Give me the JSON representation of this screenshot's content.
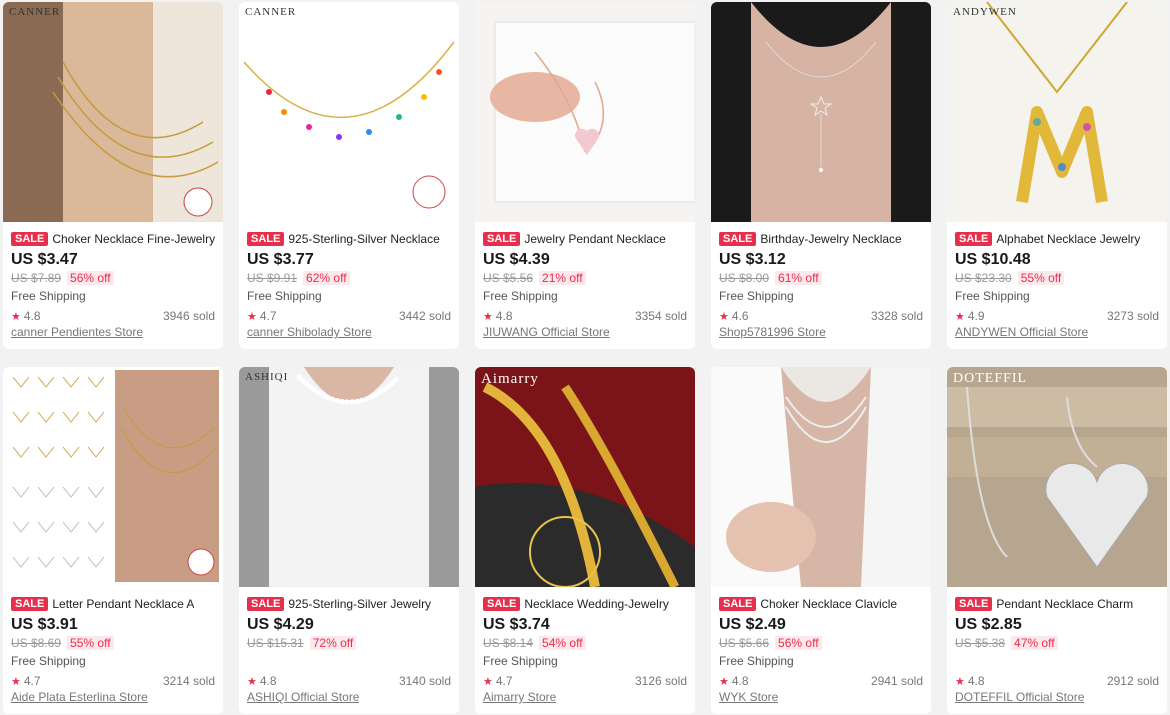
{
  "theme": {
    "sale_color": "#e62e4d",
    "background": "#f2f2f2"
  },
  "products": [
    {
      "brand": "CANNER",
      "sale": "SALE",
      "title": "Choker Necklace Fine-Jewelry",
      "price": "US $3.47",
      "old_price": "US $7.89",
      "discount": "56% off",
      "shipping": "Free Shipping",
      "rating": "4.8",
      "sold": "3946 sold",
      "store": "canner Pendientes Store"
    },
    {
      "brand": "CANNER",
      "sale": "SALE",
      "title": "925-Sterling-Silver Necklace",
      "price": "US $3.77",
      "old_price": "US $9.91",
      "discount": "62% off",
      "shipping": "Free Shipping",
      "rating": "4.7",
      "sold": "3442 sold",
      "store": "canner Shibolady Store"
    },
    {
      "brand": "",
      "sale": "SALE",
      "title": "Jewelry Pendant Necklace",
      "price": "US $4.39",
      "old_price": "US $5.56",
      "discount": "21% off",
      "shipping": "Free Shipping",
      "rating": "4.8",
      "sold": "3354 sold",
      "store": "JIUWANG Official Store"
    },
    {
      "brand": "",
      "sale": "SALE",
      "title": "Birthday-Jewelry Necklace",
      "price": "US $3.12",
      "old_price": "US $8.00",
      "discount": "61% off",
      "shipping": "Free Shipping",
      "rating": "4.6",
      "sold": "3328 sold",
      "store": "Shop5781996 Store"
    },
    {
      "brand": "ANDYWEN",
      "sale": "SALE",
      "title": "Alphabet Necklace Jewelry",
      "price": "US $10.48",
      "old_price": "US $23.30",
      "discount": "55% off",
      "shipping": "Free Shipping",
      "rating": "4.9",
      "sold": "3273 sold",
      "store": "ANDYWEN Official Store"
    },
    {
      "brand": "",
      "sale": "SALE",
      "title": "Letter Pendant Necklace A",
      "price": "US $3.91",
      "old_price": "US $8.69",
      "discount": "55% off",
      "shipping": "Free Shipping",
      "rating": "4.7",
      "sold": "3214 sold",
      "store": "Aide Plata Esterlina Store"
    },
    {
      "brand": "ASHIQI",
      "sale": "SALE",
      "title": "925-Sterling-Silver Jewelry",
      "price": "US $4.29",
      "old_price": "US $15.31",
      "discount": "72% off",
      "shipping": "",
      "rating": "4.8",
      "sold": "3140 sold",
      "store": "ASHIQI Official Store"
    },
    {
      "brand": "Aimarry",
      "sale": "SALE",
      "title": "Necklace Wedding-Jewelry",
      "price": "US $3.74",
      "old_price": "US $8.14",
      "discount": "54% off",
      "shipping": "Free Shipping",
      "rating": "4.7",
      "sold": "3126 sold",
      "store": "Aimarry Store"
    },
    {
      "brand": "",
      "sale": "SALE",
      "title": "Choker Necklace Clavicle",
      "price": "US $2.49",
      "old_price": "US $5.66",
      "discount": "56% off",
      "shipping": "Free Shipping",
      "rating": "4.8",
      "sold": "2941 sold",
      "store": "WYK Store"
    },
    {
      "brand": "DOTEFFIL",
      "sale": "SALE",
      "title": "Pendant Necklace Charm",
      "price": "US $2.85",
      "old_price": "US $5.38",
      "discount": "47% off",
      "shipping": "",
      "rating": "4.8",
      "sold": "2912 sold",
      "store": "DOTEFFIL Official Store"
    }
  ]
}
